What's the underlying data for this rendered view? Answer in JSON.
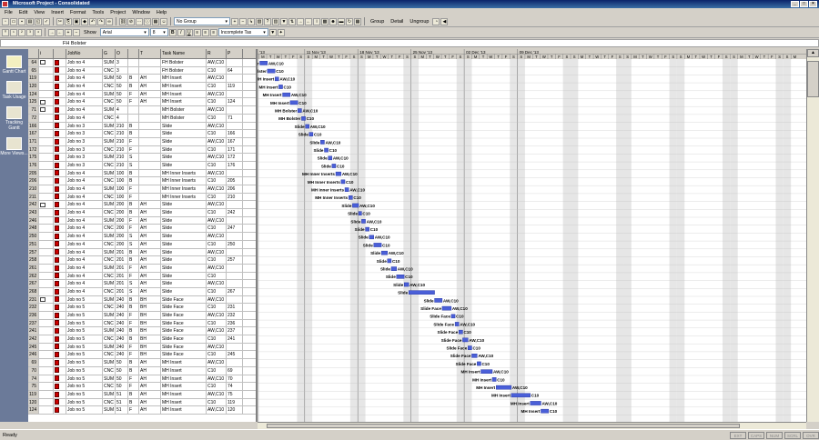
{
  "window": {
    "title": "Microsoft Project - Consolidated"
  },
  "menu": [
    "File",
    "Edit",
    "View",
    "Insert",
    "Format",
    "Tools",
    "Project",
    "Window",
    "Help"
  ],
  "toolbar1": {
    "group_select": "No Group",
    "group_btn": "Group",
    "detail_btn": "Detail",
    "ungroup_btn": "Ungroup"
  },
  "toolbar2": {
    "show_label": "Show",
    "font": "Arial",
    "font_size": "8",
    "filter": "Incomplete Tas"
  },
  "entry_bar": {
    "value": "FH Bolster"
  },
  "view_bar": [
    {
      "label": "Gantt Chart",
      "icon": "gantt-chart-icon"
    },
    {
      "label": "Task Usage",
      "icon": "task-usage-icon"
    },
    {
      "label": "Tracking Gantt",
      "icon": "tracking-gantt-icon"
    },
    {
      "label": "More Views...",
      "icon": "more-views-icon"
    }
  ],
  "columns": [
    "",
    "i",
    "",
    "JobNo",
    "G",
    "O",
    "",
    "T",
    "Task Name",
    "R",
    "P"
  ],
  "rows": [
    {
      "id": "64",
      "job": "Job no 4",
      "g": "SUM",
      "o": "3",
      "t": "",
      "task": "FH Bolster",
      "r": "AW,C10",
      "p": ""
    },
    {
      "id": "65",
      "job": "Job no 4",
      "g": "CNC",
      "o": "3",
      "t": "",
      "task": "FH Bolster",
      "r": "C10",
      "p": "64"
    },
    {
      "id": "119",
      "job": "Job no 4",
      "g": "SUM",
      "o": "50",
      "b": "B",
      "t": "AH",
      "task": "MH Insert",
      "r": "AW,C10",
      "p": ""
    },
    {
      "id": "120",
      "job": "Job no 4",
      "g": "CNC",
      "o": "50",
      "b": "B",
      "t": "AH",
      "task": "MH Insert",
      "r": "C10",
      "p": "119"
    },
    {
      "id": "124",
      "job": "Job no 4",
      "g": "SUM",
      "o": "50",
      "b": "F",
      "t": "AH",
      "task": "MH Insert",
      "r": "AW,C10",
      "p": ""
    },
    {
      "id": "125",
      "job": "Job no 4",
      "g": "CNC",
      "o": "50",
      "b": "F",
      "t": "AH",
      "task": "MH Insert",
      "r": "C10",
      "p": "124"
    },
    {
      "id": "71",
      "job": "Job no 4",
      "g": "SUM",
      "o": "4",
      "t": "",
      "task": "MH Bolster",
      "r": "AW,C10",
      "p": ""
    },
    {
      "id": "72",
      "job": "Job no 4",
      "g": "CNC",
      "o": "4",
      "t": "",
      "task": "MH Bolster",
      "r": "C10",
      "p": "71"
    },
    {
      "id": "166",
      "job": "Job no 3",
      "g": "SUM",
      "o": "210",
      "b": "B",
      "t": "",
      "task": "Slide",
      "r": "AW,C10",
      "p": ""
    },
    {
      "id": "167",
      "job": "Job no 3",
      "g": "CNC",
      "o": "210",
      "b": "B",
      "t": "",
      "task": "Slide",
      "r": "C10",
      "p": "166"
    },
    {
      "id": "171",
      "job": "Job no 3",
      "g": "SUM",
      "o": "210",
      "b": "F",
      "t": "",
      "task": "Slide",
      "r": "AW,C10",
      "p": "167"
    },
    {
      "id": "172",
      "job": "Job no 3",
      "g": "CNC",
      "o": "210",
      "b": "F",
      "t": "",
      "task": "Slide",
      "r": "C10",
      "p": "171"
    },
    {
      "id": "175",
      "job": "Job no 3",
      "g": "SUM",
      "o": "210",
      "b": "S",
      "t": "",
      "task": "Slide",
      "r": "AW,C10",
      "p": "172"
    },
    {
      "id": "176",
      "job": "Job no 3",
      "g": "CNC",
      "o": "210",
      "b": "S",
      "t": "",
      "task": "Slide",
      "r": "C10",
      "p": "176"
    },
    {
      "id": "205",
      "job": "Job no 4",
      "g": "SUM",
      "o": "100",
      "b": "B",
      "t": "",
      "task": "MH Inner Inserts",
      "r": "AW,C10",
      "p": ""
    },
    {
      "id": "206",
      "job": "Job no 4",
      "g": "CNC",
      "o": "100",
      "b": "B",
      "t": "",
      "task": "MH Inner Inserts",
      "r": "C10",
      "p": "205"
    },
    {
      "id": "210",
      "job": "Job no 4",
      "g": "SUM",
      "o": "100",
      "b": "F",
      "t": "",
      "task": "MH Inner Inserts",
      "r": "AW,C10",
      "p": "206"
    },
    {
      "id": "211",
      "job": "Job no 4",
      "g": "CNC",
      "o": "100",
      "b": "F",
      "t": "",
      "task": "MH Inner Inserts",
      "r": "C10",
      "p": "210"
    },
    {
      "id": "242",
      "job": "Job no 4",
      "g": "SUM",
      "o": "200",
      "b": "B",
      "t": "AH",
      "task": "Slide",
      "r": "AW,C10",
      "p": ""
    },
    {
      "id": "243",
      "job": "Job no 4",
      "g": "CNC",
      "o": "200",
      "b": "B",
      "t": "AH",
      "task": "Slide",
      "r": "C10",
      "p": "242"
    },
    {
      "id": "246",
      "job": "Job no 4",
      "g": "SUM",
      "o": "200",
      "b": "F",
      "t": "AH",
      "task": "Slide",
      "r": "AW,C10",
      "p": ""
    },
    {
      "id": "248",
      "job": "Job no 4",
      "g": "CNC",
      "o": "200",
      "b": "F",
      "t": "AH",
      "task": "Slide",
      "r": "C10",
      "p": "247"
    },
    {
      "id": "250",
      "job": "Job no 4",
      "g": "SUM",
      "o": "200",
      "b": "S",
      "t": "AH",
      "task": "Slide",
      "r": "AW,C10",
      "p": ""
    },
    {
      "id": "251",
      "job": "Job no 4",
      "g": "CNC",
      "o": "200",
      "b": "S",
      "t": "AH",
      "task": "Slide",
      "r": "C10",
      "p": "250"
    },
    {
      "id": "257",
      "job": "Job no 4",
      "g": "SUM",
      "o": "201",
      "b": "B",
      "t": "AH",
      "task": "Slide",
      "r": "AW,C10",
      "p": ""
    },
    {
      "id": "258",
      "job": "Job no 4",
      "g": "CNC",
      "o": "201",
      "b": "B",
      "t": "AH",
      "task": "Slide",
      "r": "C10",
      "p": "257"
    },
    {
      "id": "261",
      "job": "Job no 4",
      "g": "SUM",
      "o": "201",
      "b": "F",
      "t": "AH",
      "task": "Slide",
      "r": "AW,C10",
      "p": ""
    },
    {
      "id": "262",
      "job": "Job no 4",
      "g": "CNC",
      "o": "201",
      "b": "F",
      "t": "AH",
      "task": "Slide",
      "r": "C10",
      "p": ""
    },
    {
      "id": "267",
      "job": "Job no 4",
      "g": "SUM",
      "o": "201",
      "b": "S",
      "t": "AH",
      "task": "Slide",
      "r": "AW,C10",
      "p": ""
    },
    {
      "id": "268",
      "job": "Job no 4",
      "g": "CNC",
      "o": "201",
      "b": "S",
      "t": "AH",
      "task": "Slide",
      "r": "C10",
      "p": "267"
    },
    {
      "id": "231",
      "job": "Job no 5",
      "g": "SUM",
      "o": "240",
      "b": "B",
      "t": "BH",
      "task": "Slide Face",
      "r": "AW,C10",
      "p": ""
    },
    {
      "id": "232",
      "job": "Job no 5",
      "g": "CNC",
      "o": "240",
      "b": "B",
      "t": "BH",
      "task": "Slide Face",
      "r": "C10",
      "p": "231"
    },
    {
      "id": "236",
      "job": "Job no 5",
      "g": "SUM",
      "o": "240",
      "b": "F",
      "t": "BH",
      "task": "Slide Face",
      "r": "AW,C10",
      "p": "232"
    },
    {
      "id": "237",
      "job": "Job no 5",
      "g": "CNC",
      "o": "240",
      "b": "F",
      "t": "BH",
      "task": "Slide Face",
      "r": "C10",
      "p": "236"
    },
    {
      "id": "241",
      "job": "Job no 5",
      "g": "SUM",
      "o": "240",
      "b": "B",
      "t": "BH",
      "task": "Slide Face",
      "r": "AW,C10",
      "p": "237"
    },
    {
      "id": "242",
      "job": "Job no 5",
      "g": "CNC",
      "o": "240",
      "b": "B",
      "t": "BH",
      "task": "Slide Face",
      "r": "C10",
      "p": "241"
    },
    {
      "id": "245",
      "job": "Job no 5",
      "g": "SUM",
      "o": "240",
      "b": "F",
      "t": "BH",
      "task": "Slide Face",
      "r": "AW,C10",
      "p": ""
    },
    {
      "id": "246",
      "job": "Job no 5",
      "g": "CNC",
      "o": "240",
      "b": "F",
      "t": "BH",
      "task": "Slide Face",
      "r": "C10",
      "p": "245"
    },
    {
      "id": "69",
      "job": "Job no 5",
      "g": "SUM",
      "o": "50",
      "b": "B",
      "t": "AH",
      "task": "MH Insert",
      "r": "AW,C10",
      "p": ""
    },
    {
      "id": "70",
      "job": "Job no 5",
      "g": "CNC",
      "o": "50",
      "b": "B",
      "t": "AH",
      "task": "MH Insert",
      "r": "C10",
      "p": "69"
    },
    {
      "id": "74",
      "job": "Job no 5",
      "g": "SUM",
      "o": "50",
      "b": "F",
      "t": "AH",
      "task": "MH Insert",
      "r": "AW,C10",
      "p": "70"
    },
    {
      "id": "75",
      "job": "Job no 5",
      "g": "CNC",
      "o": "50",
      "b": "F",
      "t": "AH",
      "task": "MH Insert",
      "r": "C10",
      "p": "74"
    },
    {
      "id": "119",
      "job": "Job no 5",
      "g": "SUM",
      "o": "51",
      "b": "B",
      "t": "AH",
      "task": "MH Insert",
      "r": "AW,C10",
      "p": "75"
    },
    {
      "id": "120",
      "job": "Job no 5",
      "g": "CNC",
      "o": "51",
      "b": "B",
      "t": "AH",
      "task": "MH Insert",
      "r": "C10",
      "p": "119"
    },
    {
      "id": "124",
      "job": "Job no 5",
      "g": "SUM",
      "o": "51",
      "b": "F",
      "t": "AH",
      "task": "MH Insert",
      "r": "AW,C10",
      "p": "120"
    }
  ],
  "gantt": {
    "weeks": [
      "'13",
      "11 Nov '13",
      "18 Nov '13",
      "25 Nov '13",
      "02 Dec '13",
      "09 Dec '13"
    ],
    "days": [
      "S",
      "M",
      "T",
      "W",
      "T",
      "F",
      "S"
    ],
    "bars": [
      {
        "text": "lster",
        "res": "AW,C10",
        "start": 0,
        "dur": 1
      },
      {
        "text": "Bolster",
        "res": "C10",
        "start": 1,
        "dur": 1
      },
      {
        "text": "MH Insert",
        "res": "AW,C10",
        "start": 2,
        "dur": 0.5
      },
      {
        "text": "MH Insert",
        "res": "C10",
        "start": 2.5,
        "dur": 0.5
      },
      {
        "text": "MH Insert",
        "res": "AW,C10",
        "start": 3,
        "dur": 1
      },
      {
        "text": "MH Insert",
        "res": "C10",
        "start": 4,
        "dur": 1
      },
      {
        "text": "MH Bolster",
        "res": "AW,C10",
        "start": 5,
        "dur": 0.5
      },
      {
        "text": "MH Bolster",
        "res": "C10",
        "start": 5.5,
        "dur": 0.5
      },
      {
        "text": "Slide",
        "res": "AW,C10",
        "start": 6,
        "dur": 0.5
      },
      {
        "text": "Slide",
        "res": "C10",
        "start": 6.5,
        "dur": 0.5
      },
      {
        "text": "Slide",
        "res": "AW,C10",
        "start": 8,
        "dur": 0.5
      },
      {
        "text": "Slide",
        "res": "C10",
        "start": 8.5,
        "dur": 0.5
      },
      {
        "text": "Slide",
        "res": "AW,C10",
        "start": 9,
        "dur": 0.5
      },
      {
        "text": "Slide",
        "res": "C10",
        "start": 9.5,
        "dur": 0.5
      },
      {
        "text": "MH Inner Inserts",
        "res": "AW,C10",
        "start": 10,
        "dur": 0.7
      },
      {
        "text": "MH Inner Inserts",
        "res": "C10",
        "start": 10.7,
        "dur": 0.5
      },
      {
        "text": "MH Inner Inserts",
        "res": "AW,C10",
        "start": 11.2,
        "dur": 0.5
      },
      {
        "text": "MH Inner Inserts",
        "res": "C10",
        "start": 11.7,
        "dur": 0.5
      },
      {
        "text": "Slide",
        "res": "AW,C10",
        "start": 12.2,
        "dur": 0.8
      },
      {
        "text": "Slide",
        "res": "C10",
        "start": 13,
        "dur": 0.4
      },
      {
        "text": "Slide",
        "res": "AW,C10",
        "start": 13.4,
        "dur": 0.5
      },
      {
        "text": "Slide",
        "res": "C10",
        "start": 13.9,
        "dur": 0.5
      },
      {
        "text": "Slide",
        "res": "AW,C10",
        "start": 14.4,
        "dur": 0.6
      },
      {
        "text": "Slide",
        "res": "C10",
        "start": 15,
        "dur": 1
      },
      {
        "text": "Slide",
        "res": "AW,C10",
        "start": 16,
        "dur": 0.8
      },
      {
        "text": "Slide",
        "res": "C10",
        "start": 16.8,
        "dur": 0.5
      },
      {
        "text": "Slide",
        "res": "AW,C10",
        "start": 17.3,
        "dur": 0.7
      },
      {
        "text": "Slide",
        "res": "C10",
        "start": 18,
        "dur": 1
      },
      {
        "text": "Slide",
        "res": "AW,C10",
        "start": 19,
        "dur": 0.6
      },
      {
        "text": "Slide",
        "res": "",
        "start": 19.6,
        "dur": 3.4
      },
      {
        "text": "Slide",
        "res": "AW,C10",
        "start": 23,
        "dur": 1
      },
      {
        "text": "Slide Face",
        "res": "AW,C10",
        "start": 24,
        "dur": 1.2
      },
      {
        "text": "Slide Face",
        "res": "C10",
        "start": 25.2,
        "dur": 0.5
      },
      {
        "text": "Slide Face",
        "res": "AW,C10",
        "start": 25.7,
        "dur": 0.5
      },
      {
        "text": "Slide Face",
        "res": "C10",
        "start": 26.2,
        "dur": 0.5
      },
      {
        "text": "Slide Face",
        "res": "AW,C10",
        "start": 26.7,
        "dur": 0.7
      },
      {
        "text": "Slide Face",
        "res": "C10",
        "start": 27.4,
        "dur": 0.5
      },
      {
        "text": "Slide Face",
        "res": "AW,C10",
        "start": 27.9,
        "dur": 0.7
      },
      {
        "text": "Slide Face",
        "res": "C10",
        "start": 28.6,
        "dur": 0.5
      },
      {
        "text": "MH Insert",
        "res": "AW,C10",
        "start": 29.1,
        "dur": 1.5
      },
      {
        "text": "MH Insert",
        "res": "C10",
        "start": 30.6,
        "dur": 0.5
      },
      {
        "text": "MH Insert",
        "res": "AW,C10",
        "start": 31.1,
        "dur": 2
      },
      {
        "text": "MH Insert",
        "res": "C10",
        "start": 33.1,
        "dur": 2.5
      },
      {
        "text": "MH Insert",
        "res": "AW,C10",
        "start": 35.6,
        "dur": 1.4
      },
      {
        "text": "MH Insert",
        "res": "C10",
        "start": 37,
        "dur": 1
      }
    ]
  },
  "status": {
    "ready": "Ready",
    "indicators": [
      "EXT",
      "CAPS",
      "NUM",
      "SCRL",
      "OVR"
    ]
  },
  "colors": {
    "bar": "#4a5fd8",
    "bar_text": "#000000",
    "weekend": "#e6e6e6",
    "grid": "#c0c0c0"
  }
}
